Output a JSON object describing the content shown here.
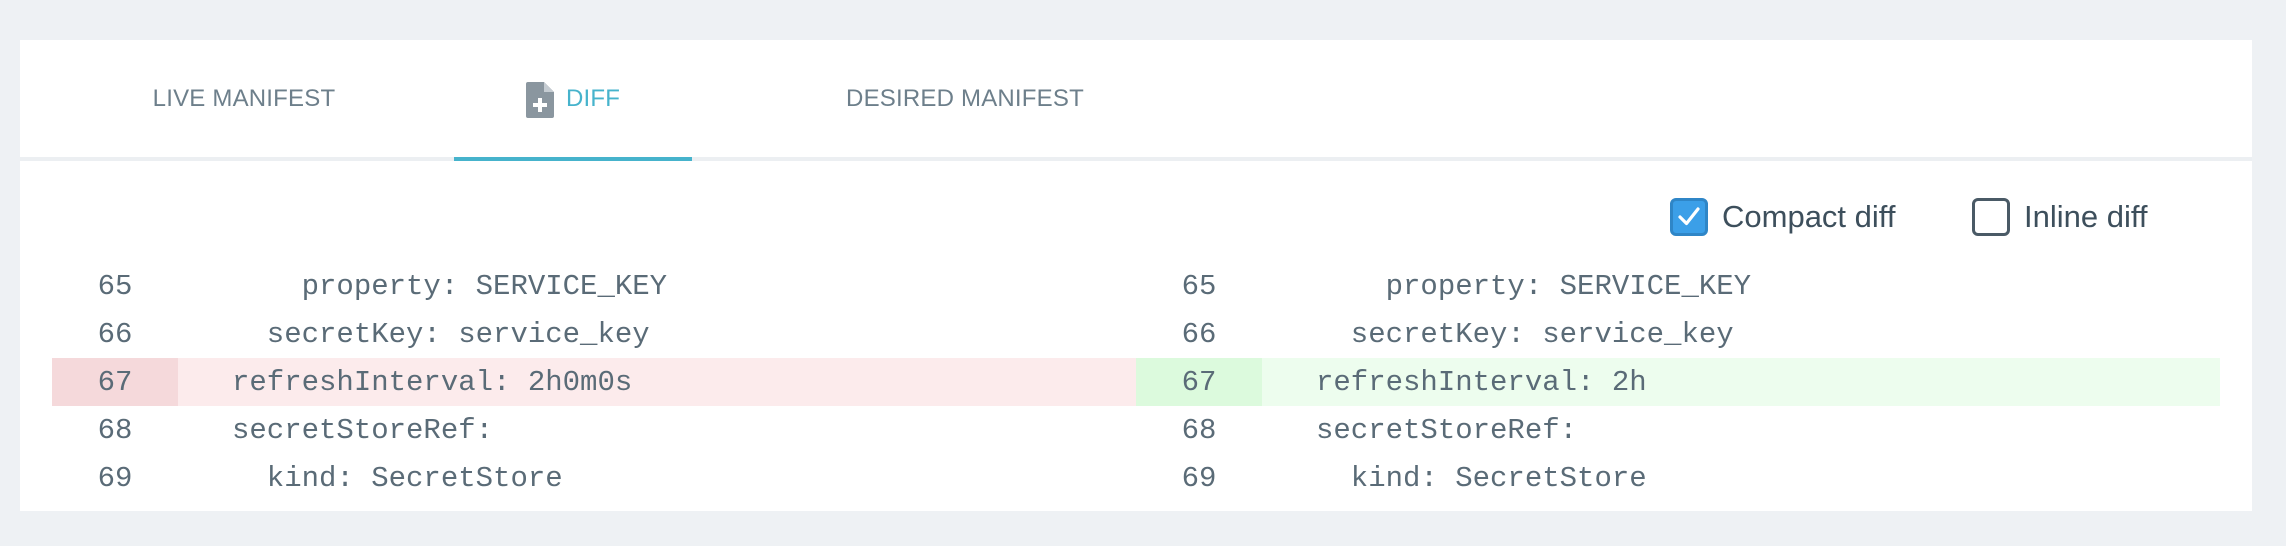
{
  "tabs": [
    {
      "label": "LIVE MANIFEST",
      "active": false
    },
    {
      "label": "DIFF",
      "active": true,
      "icon": "file-plus-icon"
    },
    {
      "label": "DESIRED MANIFEST",
      "active": false
    }
  ],
  "options": {
    "compact": {
      "label": "Compact diff",
      "checked": true
    },
    "inline": {
      "label": "Inline diff",
      "checked": false
    }
  },
  "diff": {
    "left": [
      {
        "num": "65",
        "text": "    property: SERVICE_KEY",
        "change": "none"
      },
      {
        "num": "66",
        "text": "  secretKey: service_key",
        "change": "none"
      },
      {
        "num": "67",
        "text": "refreshInterval: 2h0m0s",
        "change": "removed"
      },
      {
        "num": "68",
        "text": "secretStoreRef:",
        "change": "none"
      },
      {
        "num": "69",
        "text": "  kind: SecretStore",
        "change": "none"
      }
    ],
    "right": [
      {
        "num": "65",
        "text": "    property: SERVICE_KEY",
        "change": "none"
      },
      {
        "num": "66",
        "text": "  secretKey: service_key",
        "change": "none"
      },
      {
        "num": "67",
        "text": "refreshInterval: 2h",
        "change": "added"
      },
      {
        "num": "68",
        "text": "secretStoreRef:",
        "change": "none"
      },
      {
        "num": "69",
        "text": "  kind: SecretStore",
        "change": "none"
      }
    ]
  },
  "colors": {
    "accent": "#46b3cc",
    "checkbox": "#3b9fe8",
    "removed_bg": "#fcebec",
    "added_bg": "#edfdee"
  }
}
